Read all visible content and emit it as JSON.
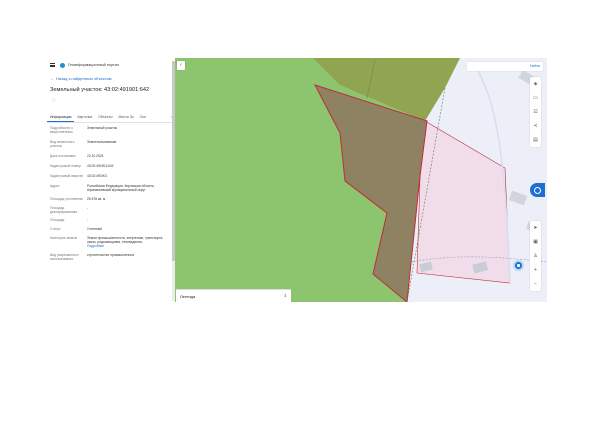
{
  "portal": {
    "title": "Геоинформационный портал"
  },
  "navigation": {
    "back_label": "Назад к найденным объектам"
  },
  "object": {
    "title": "Земельный участок: 43:02:491901:642"
  },
  "tabs": [
    {
      "label": "Информация",
      "active": true
    },
    {
      "label": "Карточка"
    },
    {
      "label": "Объекты"
    },
    {
      "label": "Места Эк"
    },
    {
      "label": "Осн"
    }
  ],
  "info_rows": [
    {
      "label": "Подробности о вещественном",
      "value": "Земельный участок"
    },
    {
      "label": "Вид земельного участка",
      "value": "Землепользование"
    },
    {
      "label": "Дата постановки",
      "value": "22.10.2024"
    },
    {
      "label": "Кадастровый номер",
      "value": "43:02:491901:642"
    },
    {
      "label": "Кадастровый квартал",
      "value": "43:02:491901"
    },
    {
      "label": "Адрес",
      "value": "Российская Федерация, Кировская область, Афанасьевский муниципальный округ"
    },
    {
      "label": "Площадь уточненная",
      "value": "26 678 кв. м"
    },
    {
      "label": "Площадь декларированная",
      "value": "-"
    },
    {
      "label": "Площадь",
      "value": "-"
    },
    {
      "label": "Статус",
      "value": "Учтенный"
    },
    {
      "label": "Категория земель",
      "value": "Земли промышленности, энергетики, транспорта, связи, радиовещания, телевидения,",
      "link": "Подробнее"
    },
    {
      "label": "Вид разрешенного использования",
      "value": "строительство промышленных"
    }
  ],
  "map": {
    "collapse_icon": "chevron-left-icon",
    "search_action": "Найти",
    "legend_label": "Легенда",
    "legend_chevron": "chevron-up-down-icon",
    "tools_top": [
      "layers-icon",
      "calendar-icon",
      "measure-icon",
      "share-icon",
      "print-icon"
    ],
    "tools_bottom": [
      "navigation-icon",
      "video-icon",
      "person-icon",
      "zoom-in-icon",
      "zoom-out-icon"
    ],
    "colors": {
      "background": "#8dc46e",
      "parcel": "#8e8262",
      "parcel_border": "#c02c3c",
      "pink_zone": "#f1dcea",
      "olive_zone": "#90a451",
      "satellite": "#eceef8",
      "accent": "#1f6fd1"
    }
  }
}
